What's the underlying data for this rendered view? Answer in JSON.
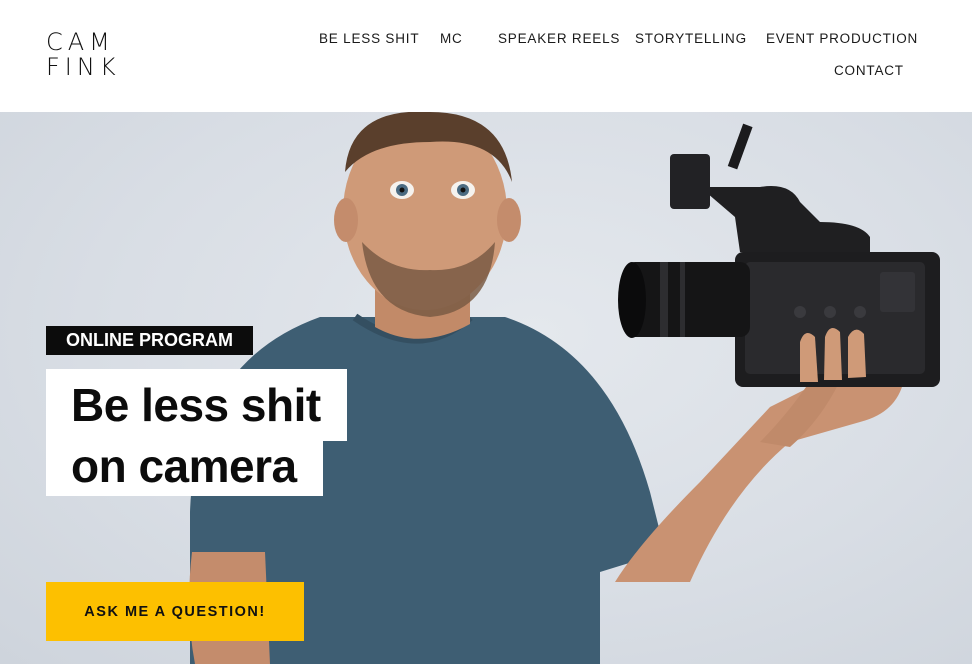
{
  "brand": {
    "line1": "CAM",
    "line2": "FINK"
  },
  "nav": {
    "items": [
      "BE LESS SHIT",
      "MC",
      "SPEAKER REELS",
      "STORYTELLING",
      "EVENT PRODUCTION",
      "CONTACT"
    ]
  },
  "hero": {
    "badge": "ONLINE PROGRAM",
    "title_line1": "Be less shit",
    "title_line2": "on camera",
    "cta": "ASK ME A QUESTION!"
  },
  "colors": {
    "accent": "#fdc000",
    "badge_bg": "#0c0c0c",
    "backdrop": "#dde2e8"
  }
}
